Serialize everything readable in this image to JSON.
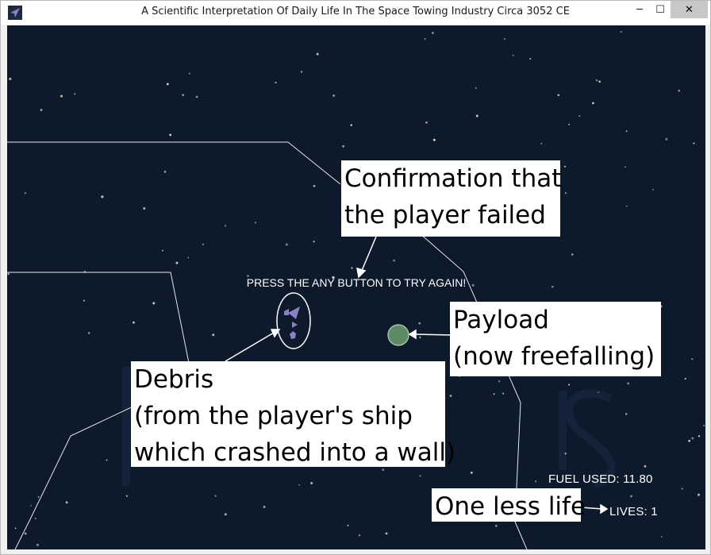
{
  "window": {
    "title": "A Scientific Interpretation Of Daily Life In The Space Towing Industry Circa 3052 CE",
    "minimize_symbol": "─",
    "maximize_symbol": "☐",
    "close_symbol": "✕"
  },
  "game": {
    "retry_message": "PRESS THE ANY BUTTON TO TRY AGAIN!",
    "fuel_used": "FUEL USED: 11.80",
    "lives": "LIVES: 1",
    "colors": {
      "background": "#0d1a2b",
      "walls": "#e6e6e6",
      "payload": "#5e8a66",
      "debris": "#8a80c8"
    }
  },
  "annotations": {
    "confirmation": "Confirmation that\nthe player failed",
    "payload": "Payload\n(now freefalling)",
    "debris": "Debris\n(from the player's ship\nwhich crashed into a wall)",
    "one_less_life": "One less life"
  },
  "icons": {
    "app": "paper-plane-icon"
  }
}
